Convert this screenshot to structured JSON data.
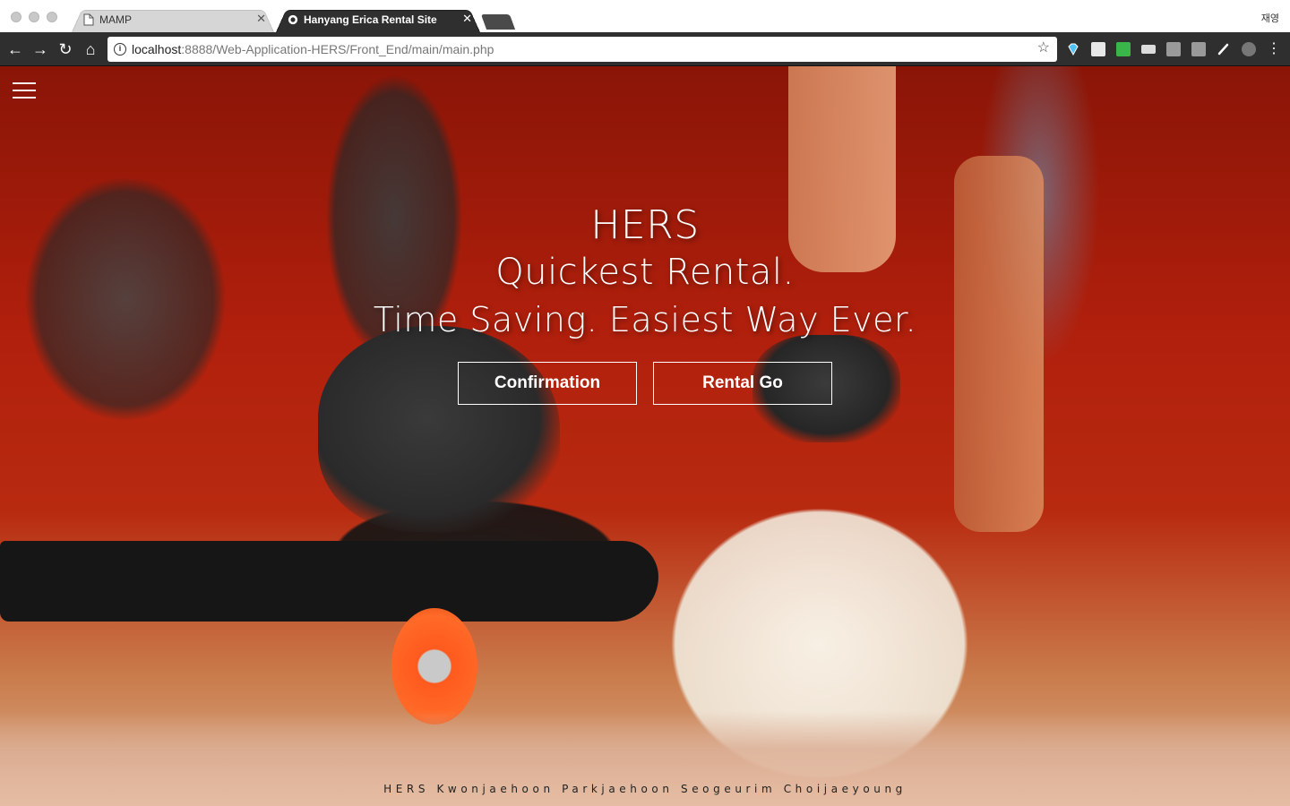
{
  "browser": {
    "tabs": [
      {
        "title": "MAMP",
        "active": false,
        "icon": "document-icon"
      },
      {
        "title": "Hanyang Erica Rental Site",
        "active": true,
        "icon": "site-favicon"
      }
    ],
    "profile_name": "재영",
    "url_host": "localhost",
    "url_path": ":8888/Web-Application-HERS/Front_End/main/main.php",
    "colors": {
      "toolbar": "#2f2f2f",
      "tab_active": "#2f2f2f"
    }
  },
  "hero": {
    "line1": "HERS",
    "line2": "Quickest Rental.",
    "line3": "Time Saving. Easiest Way Ever.",
    "buttons": {
      "confirmation": "Confirmation",
      "rental_go": "Rental Go"
    }
  },
  "footer": {
    "credits": "HERS Kwonjaehoon Parkjaehoon Seogeurim Choijaeyoung"
  }
}
